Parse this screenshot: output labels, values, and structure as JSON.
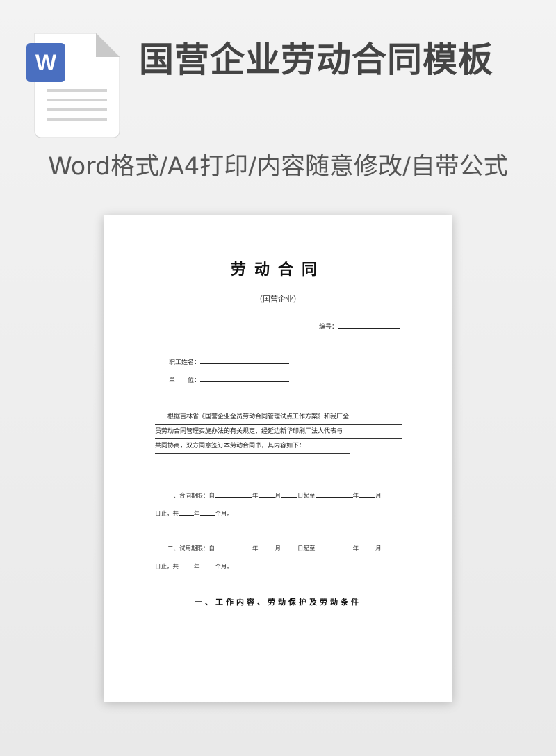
{
  "header": {
    "title": "国营企业劳动合同模板",
    "subtitle": "Word格式/A4打印/内容随意修改/自带公式",
    "icon_letter": "W",
    "icon_color": "#4a6fc0"
  },
  "document": {
    "title": "劳动合同",
    "subtitle": "（国营企业）",
    "serial_label": "编号：",
    "fields": [
      {
        "label": "职工姓名："
      },
      {
        "label": "单　　位："
      }
    ],
    "paragraph": [
      "　　根据吉林省《国营企业全员劳动合同管理试点工作方案》和我厂全",
      "员劳动合同管理实施办法的有关规定，经延边新华印刷厂法人代表与",
      "共同协商，双方同意签订本劳动合同书，其内容如下："
    ],
    "term1": {
      "lead": "一、合同期限：自",
      "y": "年",
      "m": "月",
      "d_from": "日起至",
      "y2": "年",
      "m2": "月",
      "end": "日止，共",
      "y3": "年",
      "months": "个月。"
    },
    "term2": {
      "lead": "二、试用期限：自",
      "y": "年",
      "m": "月",
      "d_from": "日起至",
      "y2": "年",
      "m2": "月",
      "end": "日止，共",
      "y3": "年",
      "months": "个月。"
    },
    "section_heading": "一、工作内容、劳动保护及劳动条件"
  }
}
